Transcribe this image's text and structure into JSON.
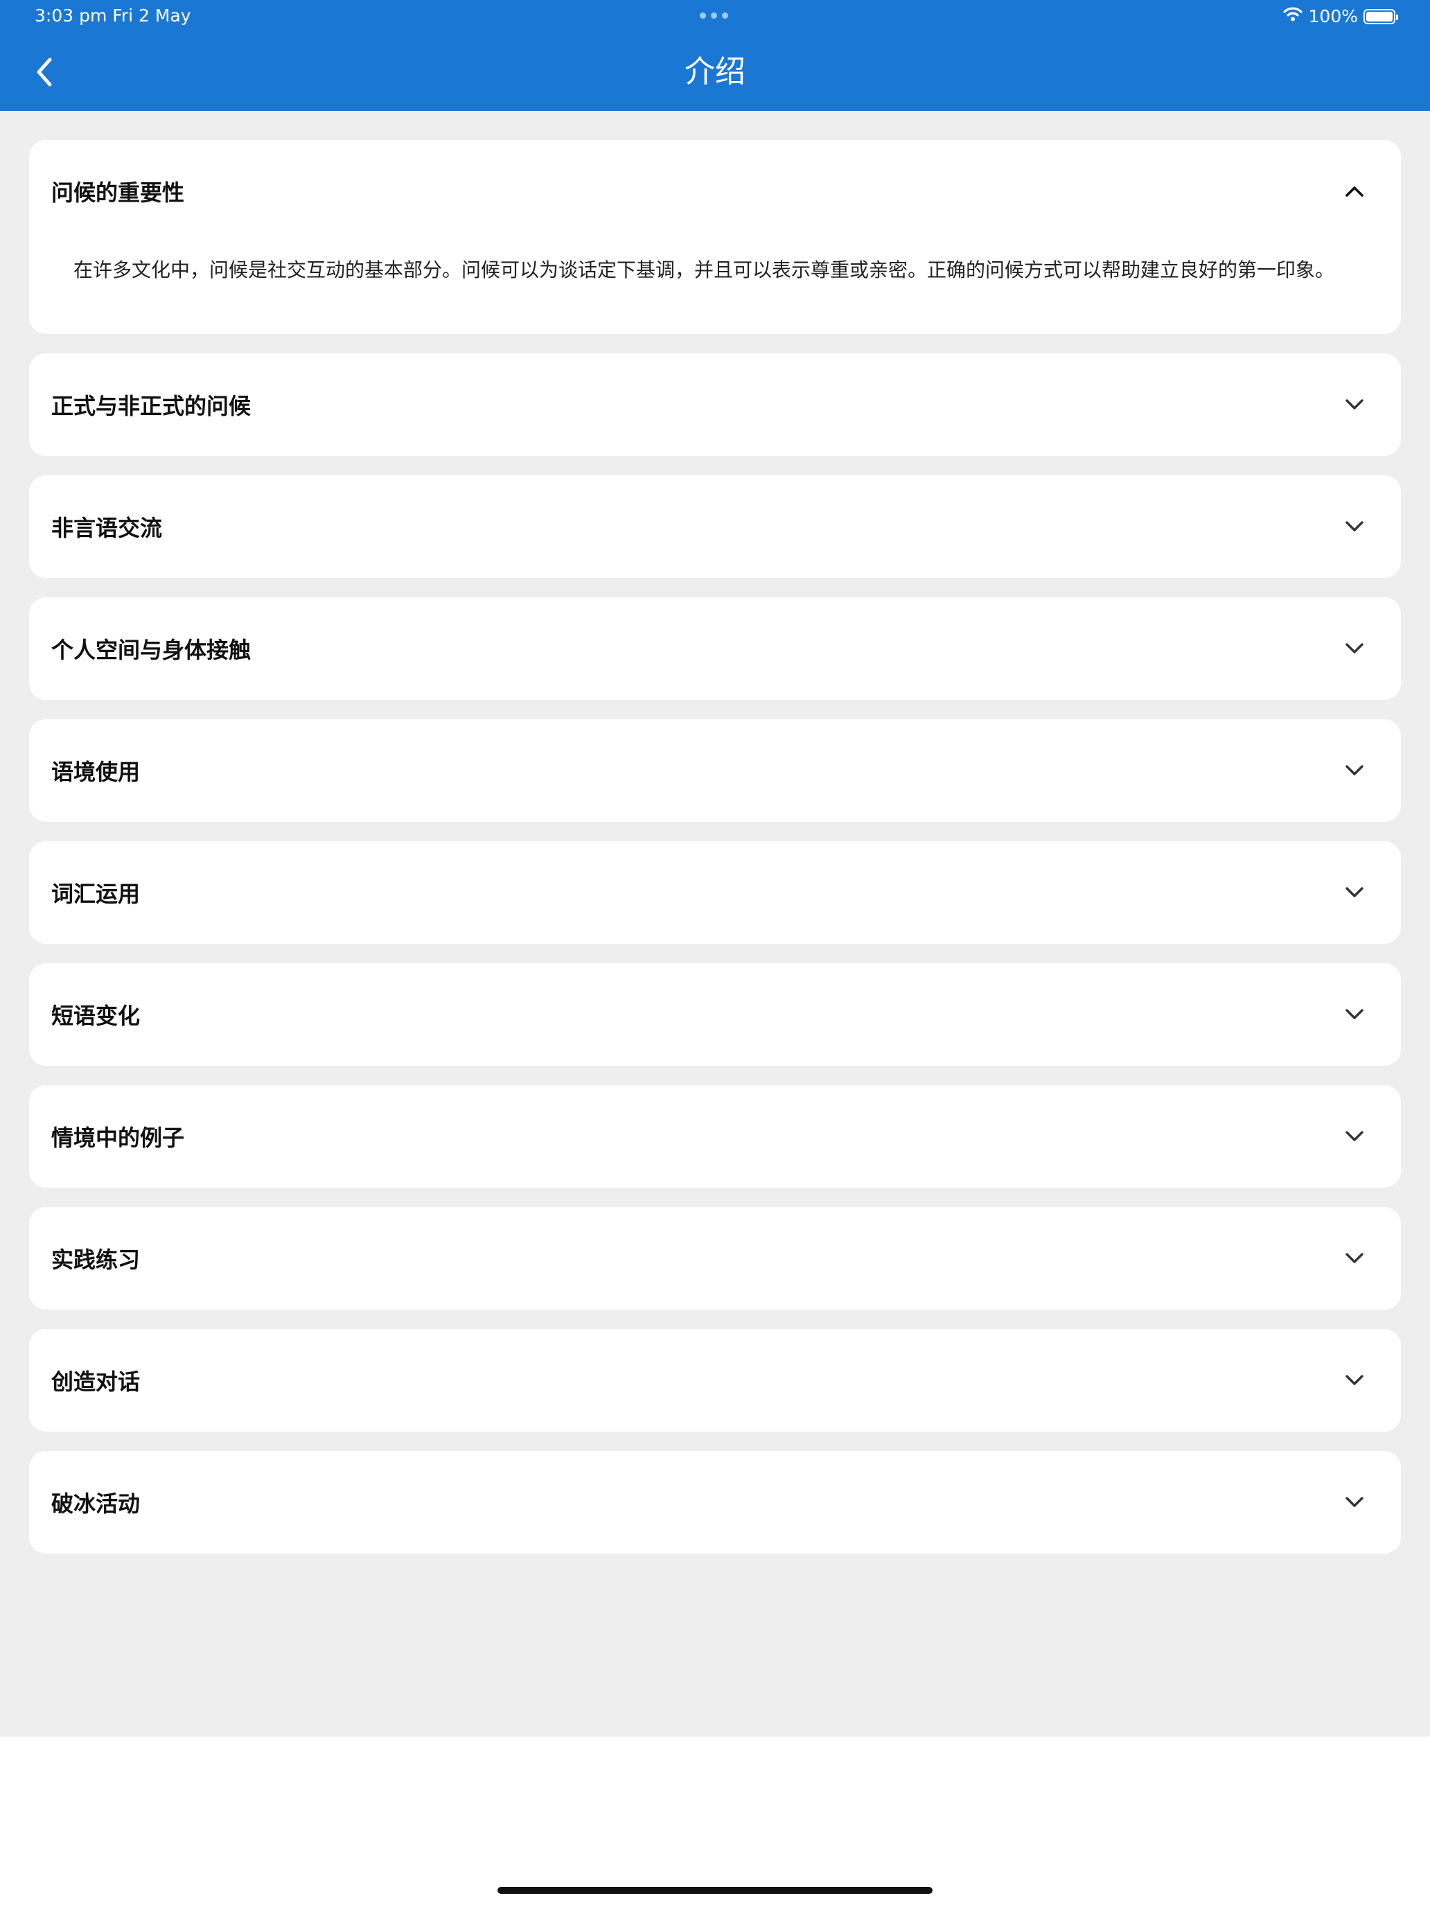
{
  "status_bar": {
    "time": "3:03 pm   Fri 2 May",
    "battery": "100%"
  },
  "nav": {
    "title": "介绍"
  },
  "sections": [
    {
      "title": "问候的重要性",
      "expanded": true,
      "content": "在许多文化中，问候是社交互动的基本部分。问候可以为谈话定下基调，并且可以表示尊重或亲密。正确的问候方式可以帮助建立良好的第一印象。"
    },
    {
      "title": "正式与非正式的问候",
      "expanded": false
    },
    {
      "title": "非言语交流",
      "expanded": false
    },
    {
      "title": "个人空间与身体接触",
      "expanded": false
    },
    {
      "title": "语境使用",
      "expanded": false
    },
    {
      "title": "词汇运用",
      "expanded": false
    },
    {
      "title": "短语变化",
      "expanded": false
    },
    {
      "title": "情境中的例子",
      "expanded": false
    },
    {
      "title": "实践练习",
      "expanded": false
    },
    {
      "title": "创造对话",
      "expanded": false
    },
    {
      "title": "破冰活动",
      "expanded": false
    }
  ],
  "colors": {
    "header": "#1b77d4",
    "background": "#eeeeee",
    "card": "#ffffff"
  },
  "icons": {
    "back": "chevron-left-icon",
    "expanded": "chevron-up-icon",
    "collapsed": "chevron-down-icon",
    "wifi": "wifi-icon",
    "battery": "battery-icon"
  }
}
